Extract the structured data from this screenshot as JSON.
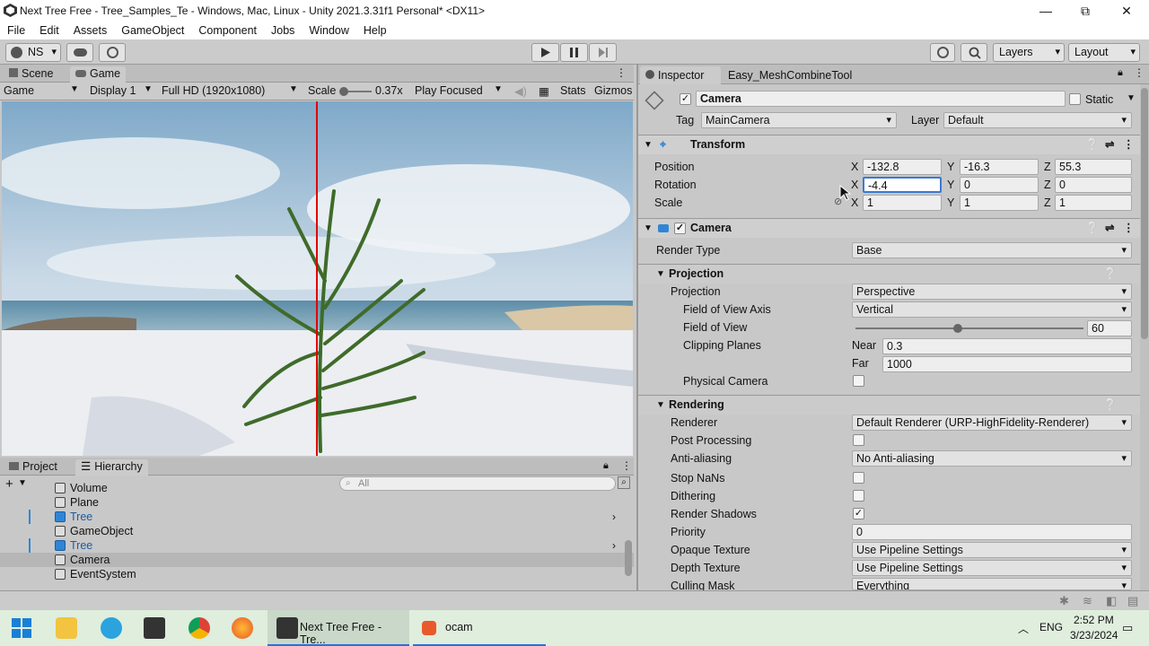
{
  "window": {
    "title": "Next Tree Free - Tree_Samples_Te - Windows, Mac, Linux - Unity 2021.3.31f1 Personal* <DX11>",
    "controls": [
      "—",
      "⧉",
      "✕"
    ]
  },
  "menu": [
    "File",
    "Edit",
    "Assets",
    "GameObject",
    "Component",
    "Jobs",
    "Window",
    "Help"
  ],
  "toolbar": {
    "account": "NS",
    "layers": "Layers",
    "layout": "Layout"
  },
  "view_tabs": {
    "scene": "Scene",
    "game": "Game"
  },
  "game_controls": {
    "mode": "Game",
    "display": "Display 1",
    "resolution": "Full HD (1920x1080)",
    "scale_label": "Scale",
    "scale_value": "0.37x",
    "play_focused": "Play Focused",
    "stats": "Stats",
    "gizmos": "Gizmos",
    "scale_slider_level": 0.1
  },
  "inspector": {
    "tabs": [
      "Inspector",
      "Easy_MeshCombineTool"
    ],
    "object_name": "Camera",
    "static_label": "Static",
    "tag_label": "Tag",
    "tag_value": "MainCamera",
    "layer_label": "Layer",
    "layer_value": "Default",
    "transform": {
      "title": "Transform",
      "position_label": "Position",
      "rotation_label": "Rotation",
      "scale_label": "Scale",
      "position": {
        "x": "-132.8",
        "y": "-16.3",
        "z": "55.3"
      },
      "rotation": {
        "x": "-4.4",
        "y": "0",
        "z": "0"
      },
      "scale": {
        "x": "1",
        "y": "1",
        "z": "1"
      },
      "axis": {
        "x": "X",
        "y": "Y",
        "z": "Z"
      }
    },
    "camera": {
      "title": "Camera",
      "render_type_label": "Render Type",
      "render_type": "Base",
      "projection_section": "Projection",
      "projection_label": "Projection",
      "projection": "Perspective",
      "fov_axis_label": "Field of View Axis",
      "fov_axis": "Vertical",
      "fov_label": "Field of View",
      "fov": "60",
      "fov_slider_level": 0.45,
      "clipping_label": "Clipping Planes",
      "near_label": "Near",
      "near": "0.3",
      "far_label": "Far",
      "far": "1000",
      "physical_label": "Physical Camera",
      "rendering_section": "Rendering",
      "renderer_label": "Renderer",
      "renderer": "Default Renderer (URP-HighFidelity-Renderer)",
      "post_label": "Post Processing",
      "aa_label": "Anti-aliasing",
      "aa": "No Anti-aliasing",
      "nan_label": "Stop NaNs",
      "dither_label": "Dithering",
      "shadows_label": "Render Shadows",
      "shadows_check": "✓",
      "priority_label": "Priority",
      "priority": "0",
      "opaque_label": "Opaque Texture",
      "opaque": "Use Pipeline Settings",
      "depth_label": "Depth Texture",
      "depth": "Use Pipeline Settings",
      "culling_label": "Culling Mask",
      "culling": "Everything"
    }
  },
  "bottom_tabs": {
    "project": "Project",
    "hierarchy": "Hierarchy"
  },
  "hierarchy": {
    "search_placeholder": "All",
    "items": [
      {
        "name": "Volume",
        "prefab": false
      },
      {
        "name": "Plane",
        "prefab": false
      },
      {
        "name": "Tree",
        "prefab": true
      },
      {
        "name": "GameObject",
        "prefab": false
      },
      {
        "name": "Tree",
        "prefab": true
      },
      {
        "name": "Camera",
        "prefab": false
      },
      {
        "name": "EventSystem",
        "prefab": false
      }
    ]
  },
  "taskbar": {
    "active_app": "Next Tree Free - Tre...",
    "ocam": "ocam",
    "lang": "ENG",
    "time": "2:52 PM",
    "date": "3/23/2024"
  },
  "colors": {
    "accent": "#2f86d6",
    "selection": "#b6b6b6",
    "red_line": "#e00000"
  }
}
